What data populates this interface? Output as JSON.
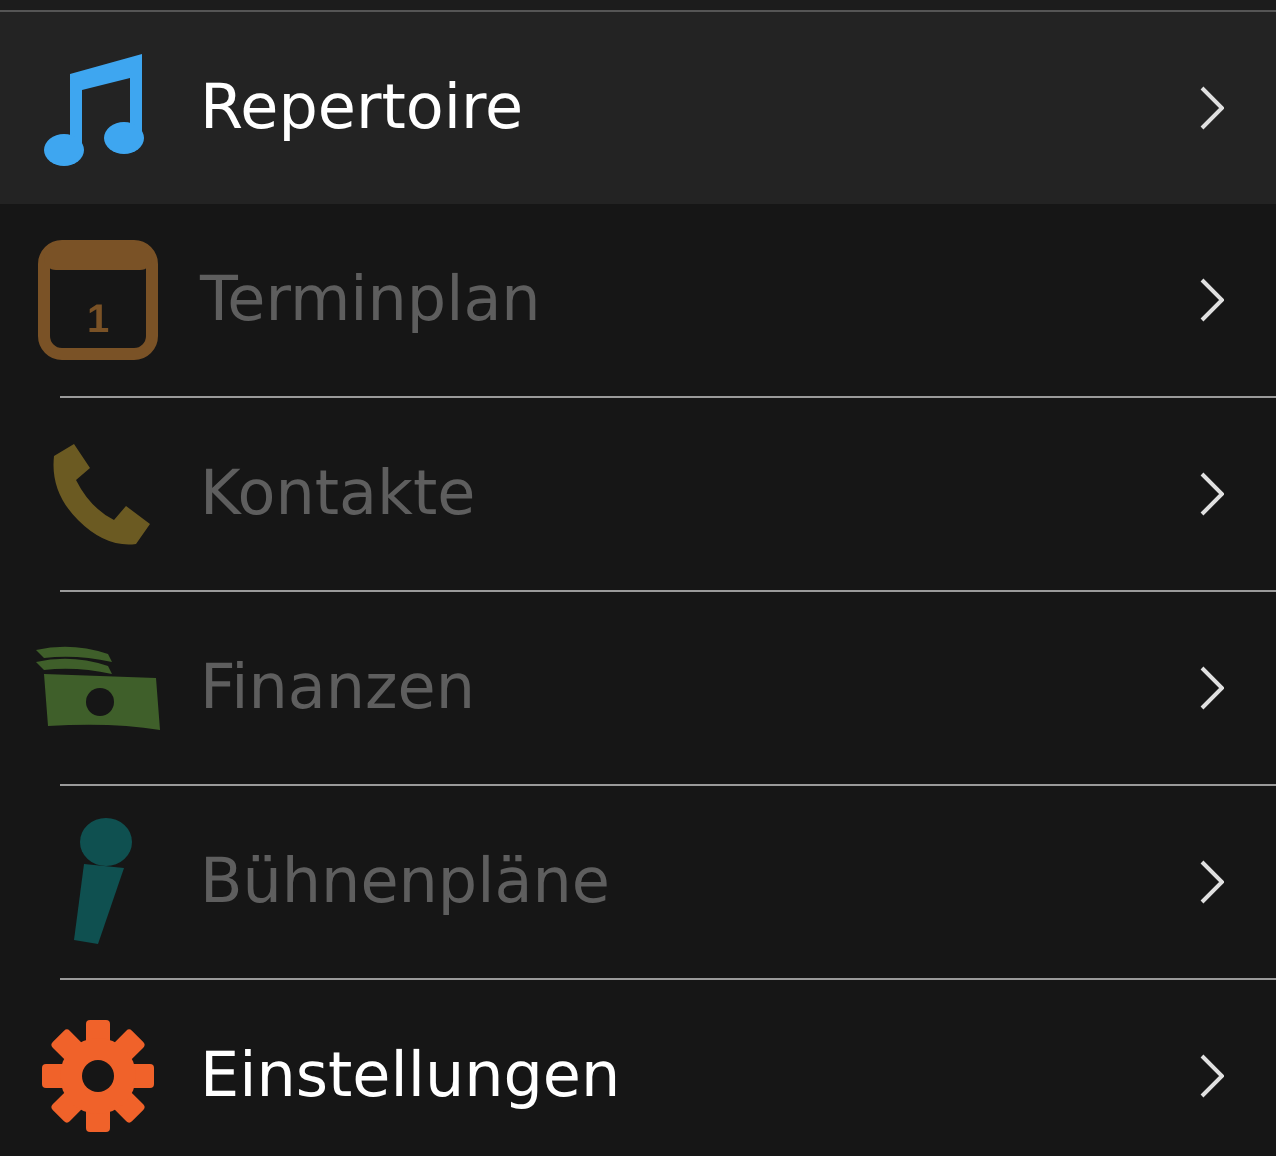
{
  "menu": [
    {
      "label": "Repertoire",
      "kind": "music",
      "color": "#3ea6f0",
      "selected": true,
      "disabled": false
    },
    {
      "label": "Terminplan",
      "kind": "calendar",
      "color": "#7a5226",
      "badge": "1",
      "selected": false,
      "disabled": true
    },
    {
      "label": "Kontakte",
      "kind": "phone",
      "color": "#6b5a22",
      "selected": false,
      "disabled": true
    },
    {
      "label": "Finanzen",
      "kind": "money",
      "color": "#3f5f2a",
      "selected": false,
      "disabled": true
    },
    {
      "label": "Bühnenpläne",
      "kind": "mic",
      "color": "#0f5050",
      "selected": false,
      "disabled": true
    },
    {
      "label": "Einstellungen",
      "kind": "gear",
      "color": "#f0622a",
      "selected": false,
      "disabled": false
    }
  ]
}
